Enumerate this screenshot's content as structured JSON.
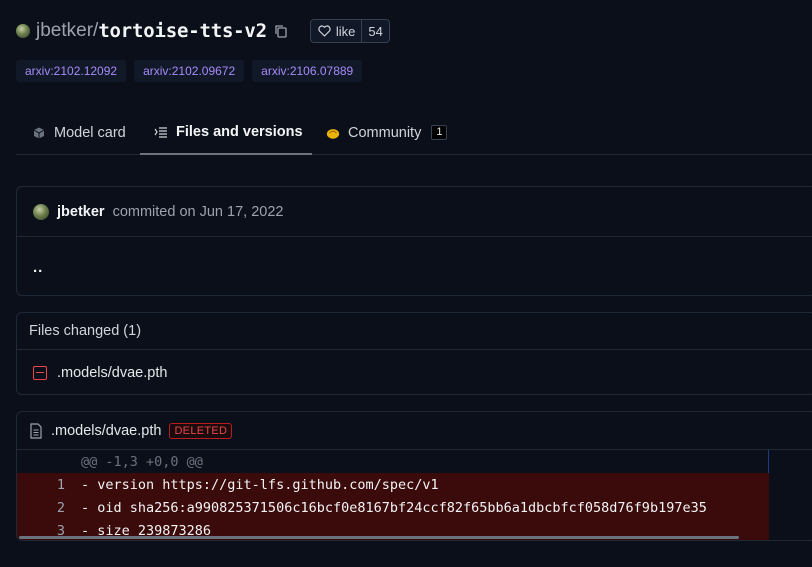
{
  "header": {
    "owner": "jbetker",
    "separator": "/",
    "model_name": "tortoise-tts-v2",
    "like_label": "like",
    "like_count": "54"
  },
  "tags": [
    "arxiv:2102.12092",
    "arxiv:2102.09672",
    "arxiv:2106.07889"
  ],
  "tabs": [
    {
      "label": "Model card",
      "icon": "cube-icon",
      "active": false
    },
    {
      "label": "Files and versions",
      "icon": "files-icon",
      "active": true
    },
    {
      "label": "Community",
      "icon": "hands-icon",
      "active": false,
      "count": "1"
    }
  ],
  "commit": {
    "author": "jbetker",
    "meta": "commited on Jun 17, 2022",
    "message": ".."
  },
  "files_changed": {
    "title": "Files changed (1)",
    "files": [
      ".models/dvae.pth"
    ]
  },
  "diff": {
    "filename": ".models/dvae.pth",
    "status": "DELETED",
    "hunk": "@@ -1,3 +0,0 @@",
    "lines": [
      {
        "num": "1",
        "text": "- version https://git-lfs.github.com/spec/v1"
      },
      {
        "num": "2",
        "text": "- oid sha256:a990825371506c16bcf0e8167bf24ccf82f65bb6a1dbcbfcf058d76f9b197e35"
      },
      {
        "num": "3",
        "text": "- size 239873286"
      }
    ]
  },
  "colors": {
    "background": "#0b0f19",
    "tag_text": "#a78bfa",
    "deleted": "#ef4444",
    "deleted_row": "#3b0a0a"
  }
}
